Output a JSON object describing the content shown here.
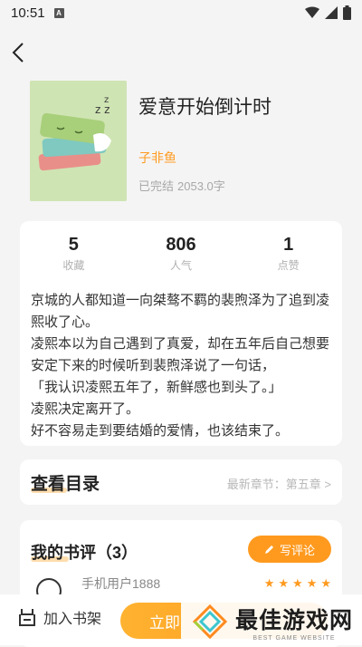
{
  "status_bar": {
    "time": "10:51",
    "notif_icon": "a-icon"
  },
  "book": {
    "title": "爱意开始倒计时",
    "author": "子非鱼",
    "state": "已完结",
    "word_count": "2053.0字",
    "cover_icon": "sleeping-book-cover"
  },
  "stats": [
    {
      "value": "5",
      "label": "收藏"
    },
    {
      "value": "806",
      "label": "人气"
    },
    {
      "value": "1",
      "label": "点赞"
    }
  ],
  "description": [
    "京城的人都知道一向桀骜不羁的裴煦泽为了追到凌熙收了心。",
    "凌熙本以为自己遇到了真爱，却在五年后自己想要安定下来的时候听到裴煦泽说了一句话，",
    "「我认识凌熙五年了，新鲜感也到头了。」",
    "凌熙决定离开了。",
    "好不容易走到要结婚的爱情，也该结束了。"
  ],
  "toc": {
    "title": "查看目录",
    "latest": "最新章节：第五章 >"
  },
  "reviews": {
    "title": "我的书评（3）",
    "write_label": "写评论",
    "first_user": "手机用户1888",
    "rating": 5
  },
  "bottom": {
    "shelf_label": "加入书架",
    "read_label": "立即"
  },
  "watermark": {
    "cn": "最佳游戏网",
    "en": "BEST GAME WEBSITE"
  },
  "colors": {
    "accent": "#ff9a1f",
    "highlight": "#ffd599"
  }
}
